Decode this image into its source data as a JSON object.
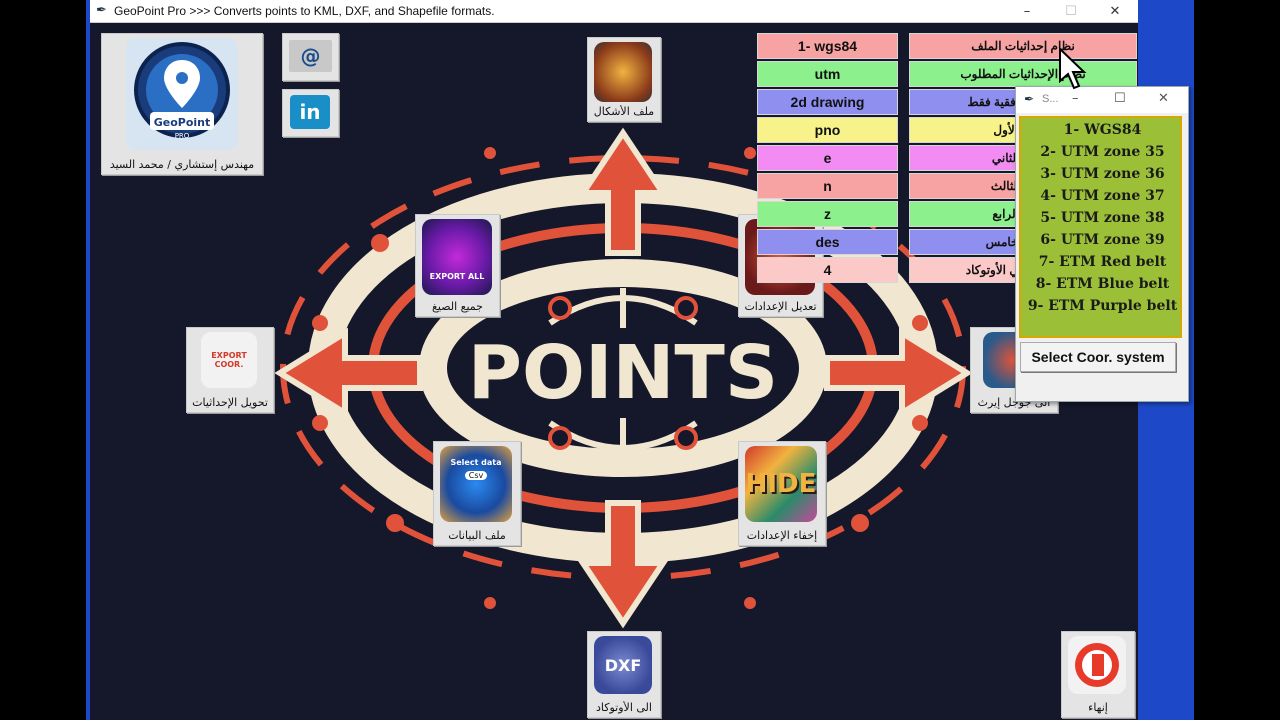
{
  "window": {
    "title": "GeoPoint Pro  >>>   Converts points to KML, DXF, and Shapefile formats.",
    "minimize": "–",
    "maximize": "☐",
    "close": "✕"
  },
  "background": {
    "headline": "POINTS"
  },
  "logo": {
    "brand": "GeoPoint",
    "sub": "PRO",
    "caption": "مهندس إستشاري / محمد السيد"
  },
  "icons": {
    "email": "@",
    "linkedin": "in",
    "shapes": {
      "caption": "ملف الأشكال",
      "icon": "shapes-badge-icon"
    },
    "export_all": {
      "caption": "جميع الصيغ",
      "label": "EXPORT ALL"
    },
    "settings": {
      "caption": "تعديل الإعدادات"
    },
    "convert": {
      "caption": "تحويل الإحداثيات",
      "label": "EXPORT COOR."
    },
    "google_earth": {
      "caption": "الى جوجل إيرث"
    },
    "data_file": {
      "caption": "ملف البيانات",
      "label": "Select data",
      "badge": "Csv"
    },
    "hide": {
      "caption": "إخفاء الإعدادات",
      "label": "HIDE"
    },
    "autocad": {
      "caption": "الى الأوتوكاد",
      "label": "DXF"
    },
    "exit": {
      "caption": "إنهاء"
    }
  },
  "left_column": [
    "1- wgs84",
    "utm",
    "2d drawing",
    "pno",
    "e",
    "n",
    "z",
    "des",
    "4"
  ],
  "right_column": [
    "نظام إحداثيات الملف",
    "نظام الإحداثيات المطلوب",
    "الإحداثيات الأفقية فقط",
    "العمود الأول",
    "العمود الثاني",
    "العمود الثالث",
    "العمود الرابع",
    "العمود الخامس",
    "حجم النص في الأوتوكاد"
  ],
  "colors": {
    "row": [
      "#f7a3a3",
      "#8cf08c",
      "#8f8ff0",
      "#f7f28a",
      "#f28cf2",
      "#f7a3a3",
      "#8cf08c",
      "#8f8ff0",
      "#fcc9c9"
    ]
  },
  "dialog": {
    "title": "S...",
    "minimize": "–",
    "maximize": "☐",
    "close": "✕",
    "items": [
      "1- WGS84",
      "2- UTM zone 35",
      "3- UTM zone 36",
      "4- UTM zone 37",
      "5- UTM zone 38",
      "6- UTM zone 39",
      "7- ETM Red belt",
      "8- ETM Blue belt",
      "9- ETM Purple belt"
    ],
    "button": "Select Coor. system"
  }
}
